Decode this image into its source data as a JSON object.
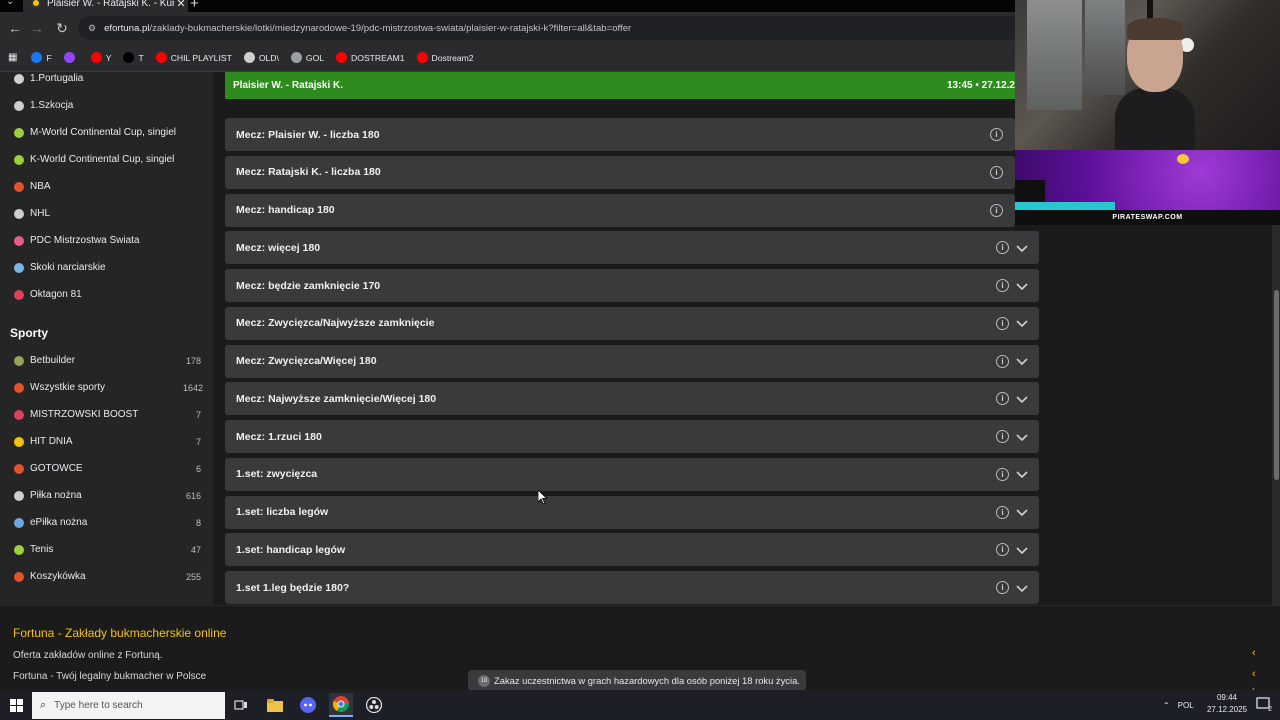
{
  "browser": {
    "tab_title": "Plaisier W. - Ratajski K. - Kursy",
    "url_host": "efortuna.pl",
    "url_path": "/zaklady-bukmacherskie/lotki/miedzynarodowe-19/pdc-mistrzostwa-swiata/plaisier-w-ratajski-k?filter=all&tab=offer",
    "bookmarks": [
      {
        "label": "F",
        "icon": "facebook-icon",
        "color": "#1877f2"
      },
      {
        "label": "",
        "icon": "twitch-icon",
        "color": "#9146ff"
      },
      {
        "label": "Y",
        "icon": "youtube-icon",
        "color": "#ff0000"
      },
      {
        "label": "T",
        "icon": "x-icon",
        "color": "#000000"
      },
      {
        "label": "CHIL PLAYLIST",
        "icon": "youtube-icon",
        "color": "#ff0000"
      },
      {
        "label": "OLD\\",
        "icon": "folder-icon",
        "color": "#cfcfcf"
      },
      {
        "label": "GOL",
        "icon": "gol-icon",
        "color": "#9aa0a6"
      },
      {
        "label": "DOSTREAM1",
        "icon": "youtube-icon",
        "color": "#ff0000"
      },
      {
        "label": "Dostream2",
        "icon": "youtube-icon",
        "color": "#ff0000"
      }
    ]
  },
  "sidebar": {
    "top_items": [
      {
        "label": "1.Portugalia",
        "icon": "soccer-ball-icon",
        "color": "#d0d0d0"
      },
      {
        "label": "1.Szkocja",
        "icon": "soccer-ball-icon",
        "color": "#d0d0d0"
      },
      {
        "label": "M-World Continental Cup, singiel",
        "icon": "tennis-ball-icon",
        "color": "#9bd23c"
      },
      {
        "label": "K-World Continental Cup, singiel",
        "icon": "tennis-ball-icon",
        "color": "#9bd23c"
      },
      {
        "label": "NBA",
        "icon": "basketball-icon",
        "color": "#e2532b"
      },
      {
        "label": "NHL",
        "icon": "hockey-icon",
        "color": "#cfcfcf"
      },
      {
        "label": "PDC Mistrzostwa Świata",
        "icon": "dart-icon",
        "color": "#e85d8a"
      },
      {
        "label": "Skoki narciarskie",
        "icon": "ski-jump-icon",
        "color": "#7ab8e0"
      },
      {
        "label": "Oktagon 81",
        "icon": "mma-icon",
        "color": "#e0405c"
      }
    ],
    "section_title": "Sporty",
    "sports": [
      {
        "label": "Betbuilder",
        "count": "178",
        "icon": "betbuilder-icon",
        "color": "#9aa35a"
      },
      {
        "label": "Wszystkie sporty",
        "count": "1642",
        "icon": "all-sports-icon",
        "color": "#e2532b"
      },
      {
        "label": "MISTRZOWSKI BOOST",
        "count": "7",
        "icon": "boost-icon",
        "color": "#e0405c"
      },
      {
        "label": "HIT DNIA",
        "count": "7",
        "icon": "hit-icon",
        "color": "#f4c20d"
      },
      {
        "label": "GOTOWCE",
        "count": "6",
        "icon": "fire-icon",
        "color": "#e2532b"
      },
      {
        "label": "Piłka nożna",
        "count": "616",
        "icon": "soccer-ball-icon",
        "color": "#d0d0d0"
      },
      {
        "label": "ePiłka nożna",
        "count": "8",
        "icon": "esoccer-icon",
        "color": "#6fa8dc"
      },
      {
        "label": "Tenis",
        "count": "47",
        "icon": "tennis-ball-icon",
        "color": "#9bd23c"
      },
      {
        "label": "Koszykówka",
        "count": "255",
        "icon": "basketball-icon",
        "color": "#e2532b"
      }
    ]
  },
  "match": {
    "teams": "Plaisier W.  -  Ratajski K.",
    "datetime": "13:45  •  27.12.2"
  },
  "markets": [
    {
      "label": "Mecz: Plaisier W. - liczba 180",
      "chevron": false
    },
    {
      "label": "Mecz: Ratajski K. - liczba 180",
      "chevron": false
    },
    {
      "label": "Mecz: handicap 180",
      "chevron": false
    },
    {
      "label": "Mecz: więcej 180",
      "chevron": true
    },
    {
      "label": "Mecz: będzie zamknięcie 170",
      "chevron": true
    },
    {
      "label": "Mecz: Zwycięzca/Najwyższe zamknięcie",
      "chevron": true
    },
    {
      "label": "Mecz: Zwycięzca/Więcej 180",
      "chevron": true
    },
    {
      "label": "Mecz: Najwyższe zamknięcie/Więcej 180",
      "chevron": true
    },
    {
      "label": "Mecz: 1.rzuci 180",
      "chevron": true
    },
    {
      "label": "1.set: zwycięzca",
      "chevron": true
    },
    {
      "label": "1.set: liczba legów",
      "chevron": true
    },
    {
      "label": "1.set: handicap legów",
      "chevron": true
    },
    {
      "label": "1.set 1.leg będzie 180?",
      "chevron": true
    }
  ],
  "footer": {
    "title": "Fortuna - Zakłady bukmacherskie online",
    "line1": "Oferta zakładów online z Fortuną.",
    "line2": "Fortuna - Twój legalny bukmacher w Polsce",
    "disclaimer": "Zakaz uczestnictwa w grach hazardowych dla osób poniżej 18 roku życia.",
    "disclaimer_badge": "18"
  },
  "overlay": {
    "promo_text": "PIRATESWAP.COM"
  },
  "taskbar": {
    "search_placeholder": "Type here to search",
    "language": "POL",
    "time": "09:44",
    "date": "27.12.2025",
    "notification_count": "2"
  }
}
